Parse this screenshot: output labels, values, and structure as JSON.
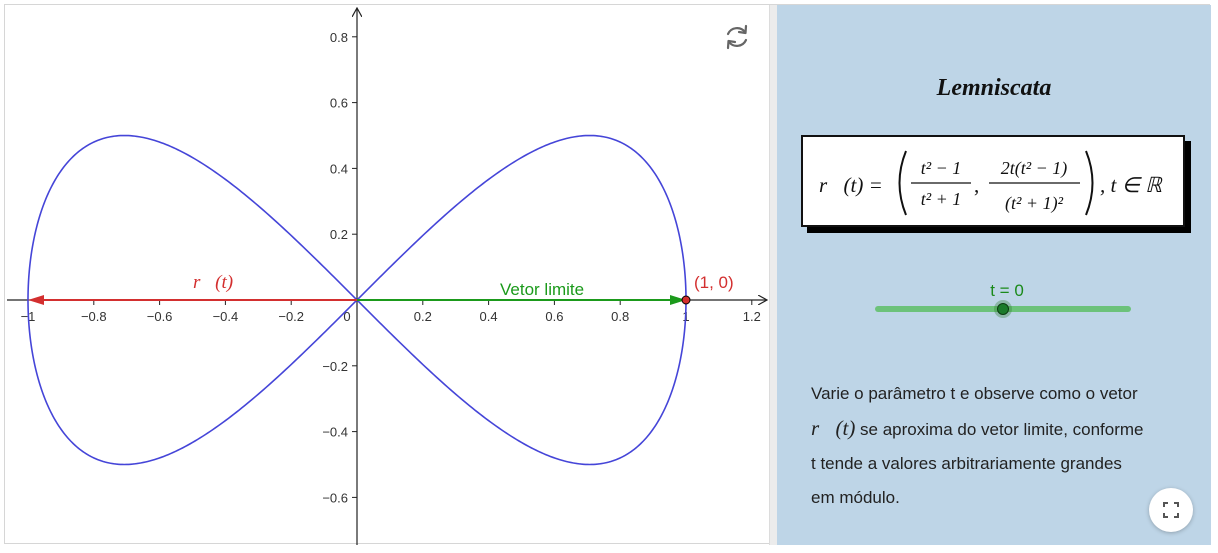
{
  "graph": {
    "x_ticks": [
      "−1",
      "−0.8",
      "−0.6",
      "−0.4",
      "−0.2",
      "0",
      "0.2",
      "0.4",
      "0.6",
      "0.8",
      "1",
      "1.2"
    ],
    "y_ticks": [
      "0.8",
      "0.6",
      "0.4",
      "0.2",
      "−0.2",
      "−0.4",
      "−0.6"
    ],
    "x_tick_values": [
      -1,
      -0.8,
      -0.6,
      -0.4,
      -0.2,
      0,
      0.2,
      0.4,
      0.6,
      0.8,
      1,
      1.2
    ],
    "y_tick_values": [
      0.8,
      0.6,
      0.4,
      0.2,
      -0.2,
      -0.4,
      -0.6
    ],
    "vector_label": "r⃗(t)",
    "limit_label": "Vetor limite",
    "point_label": "(1, 0)",
    "curve_color": "#4545d8",
    "vector_color": "#d32f2f",
    "limit_color": "#1b9a1b",
    "vector_endpoint": [
      -1,
      0
    ],
    "limit_endpoint": [
      1,
      0
    ]
  },
  "panel": {
    "title": "Lemniscata",
    "formula": {
      "lhs": "r⃗(t) =",
      "num1": "t² − 1",
      "den1": "t² + 1",
      "num2": "2t(t² − 1)",
      "den2": "(t² + 1)²",
      "tail": ", t ∈ ℝ"
    },
    "slider_label": "t = 0",
    "slider_value": 0,
    "description": {
      "line1": "Varie o parâmetro t e observe como o vetor",
      "line2_vec": "r⃗(t)",
      "line2_rest": " se aproxima do vetor limite, conforme",
      "line3": "t tende a valores arbitrariamente grandes",
      "line4": "em módulo."
    }
  },
  "icons": {
    "reset": "reset-icon",
    "fullscreen": "fullscreen-icon"
  }
}
